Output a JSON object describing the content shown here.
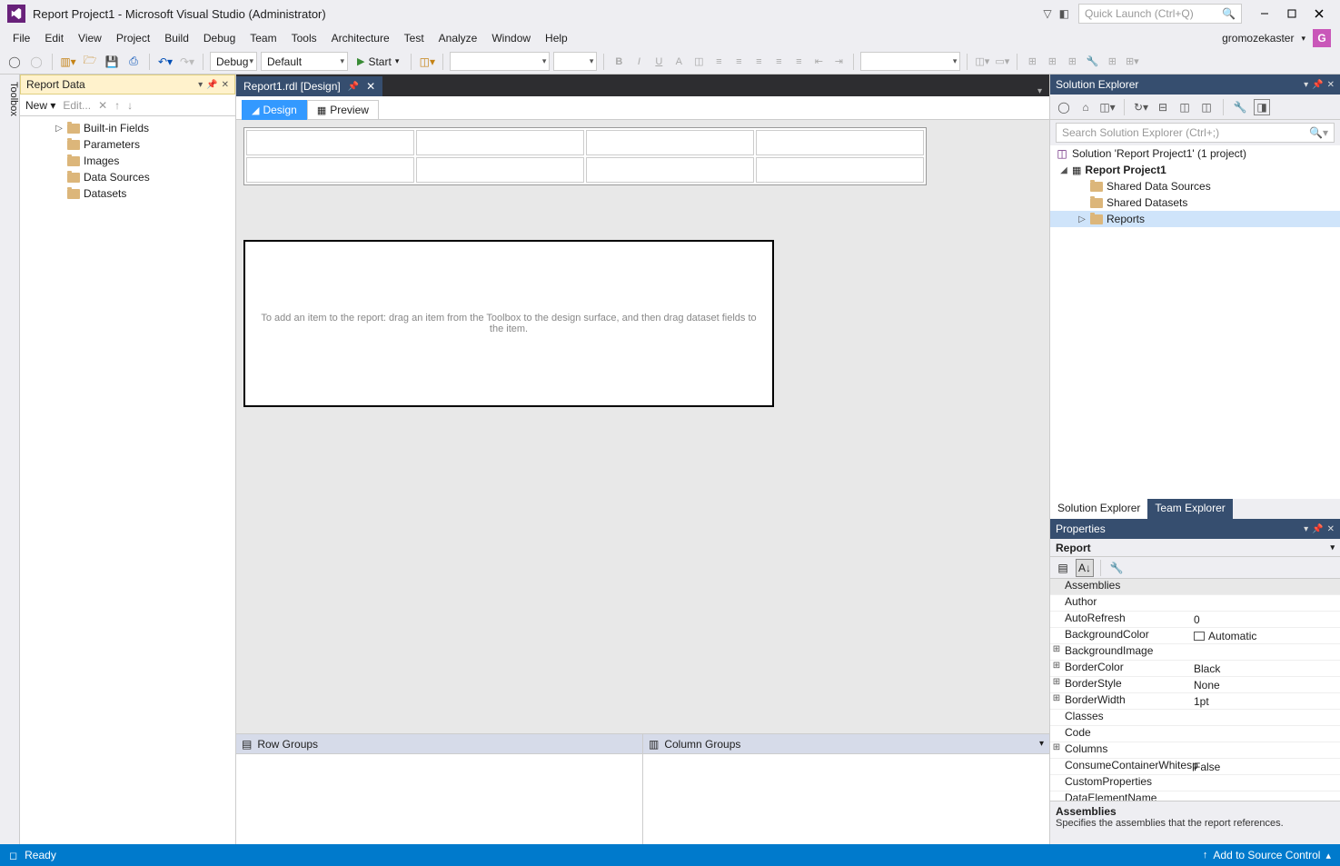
{
  "title": "Report Project1 - Microsoft Visual Studio  (Administrator)",
  "quick_launch_placeholder": "Quick Launch (Ctrl+Q)",
  "menus": [
    "File",
    "Edit",
    "View",
    "Project",
    "Build",
    "Debug",
    "Team",
    "Tools",
    "Architecture",
    "Test",
    "Analyze",
    "Window",
    "Help"
  ],
  "user": {
    "name": "gromozekaster",
    "initial": "G"
  },
  "toolbar": {
    "config": "Debug",
    "platform": "Default",
    "start": "Start"
  },
  "report_data": {
    "title": "Report Data",
    "tb_new": "New",
    "tb_edit": "Edit...",
    "items": [
      "Built-in Fields",
      "Parameters",
      "Images",
      "Data Sources",
      "Datasets"
    ]
  },
  "toolbox_tab": "Toolbox",
  "doc_tab": {
    "label": "Report1.rdl [Design]"
  },
  "design_tabs": {
    "design": "Design",
    "preview": "Preview"
  },
  "hint": "To add an item to the report: drag an item from the Toolbox to the design surface, and then drag dataset fields to the item.",
  "groups": {
    "row": "Row Groups",
    "col": "Column Groups"
  },
  "solution_explorer": {
    "title": "Solution Explorer",
    "search_placeholder": "Search Solution Explorer (Ctrl+;)",
    "solution": "Solution 'Report Project1' (1 project)",
    "project": "Report Project1",
    "nodes": [
      "Shared Data Sources",
      "Shared Datasets",
      "Reports"
    ],
    "tabs": {
      "se": "Solution Explorer",
      "te": "Team Explorer"
    }
  },
  "properties": {
    "title": "Properties",
    "target": "Report",
    "rows": [
      {
        "exp": "",
        "name": "Assemblies",
        "val": "",
        "sel": true
      },
      {
        "exp": "",
        "name": "Author",
        "val": ""
      },
      {
        "exp": "",
        "name": "AutoRefresh",
        "val": "0"
      },
      {
        "exp": "",
        "name": "BackgroundColor",
        "val": "Automatic",
        "color": true
      },
      {
        "exp": "+",
        "name": "BackgroundImage",
        "val": ""
      },
      {
        "exp": "+",
        "name": "BorderColor",
        "val": "Black"
      },
      {
        "exp": "+",
        "name": "BorderStyle",
        "val": "None"
      },
      {
        "exp": "+",
        "name": "BorderWidth",
        "val": "1pt"
      },
      {
        "exp": "",
        "name": "Classes",
        "val": ""
      },
      {
        "exp": "",
        "name": "Code",
        "val": ""
      },
      {
        "exp": "+",
        "name": "Columns",
        "val": ""
      },
      {
        "exp": "",
        "name": "ConsumeContainerWhitesp",
        "val": "False"
      },
      {
        "exp": "",
        "name": "CustomProperties",
        "val": ""
      },
      {
        "exp": "",
        "name": "DataElementName",
        "val": ""
      }
    ],
    "desc_title": "Assemblies",
    "desc_text": "Specifies the assemblies that the report references."
  },
  "status": {
    "ready": "Ready",
    "source_control": "Add to Source Control"
  }
}
